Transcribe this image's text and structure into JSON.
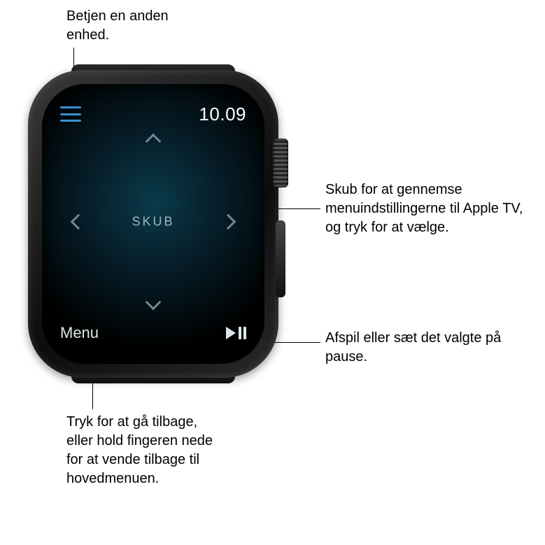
{
  "callouts": {
    "devices": "Betjen en anden enhed.",
    "swipe": "Skub for at gennemse menuindstillingerne til Apple TV, og tryk for at vælge.",
    "playpause": "Afspil eller sæt det valgte på pause.",
    "menu": "Tryk for at gå tilbage, eller hold fingeren nede for at vende tilbage til hovedmenuen."
  },
  "watch": {
    "time": "10.09",
    "swipe_label": "SKUB",
    "menu_label": "Menu"
  }
}
